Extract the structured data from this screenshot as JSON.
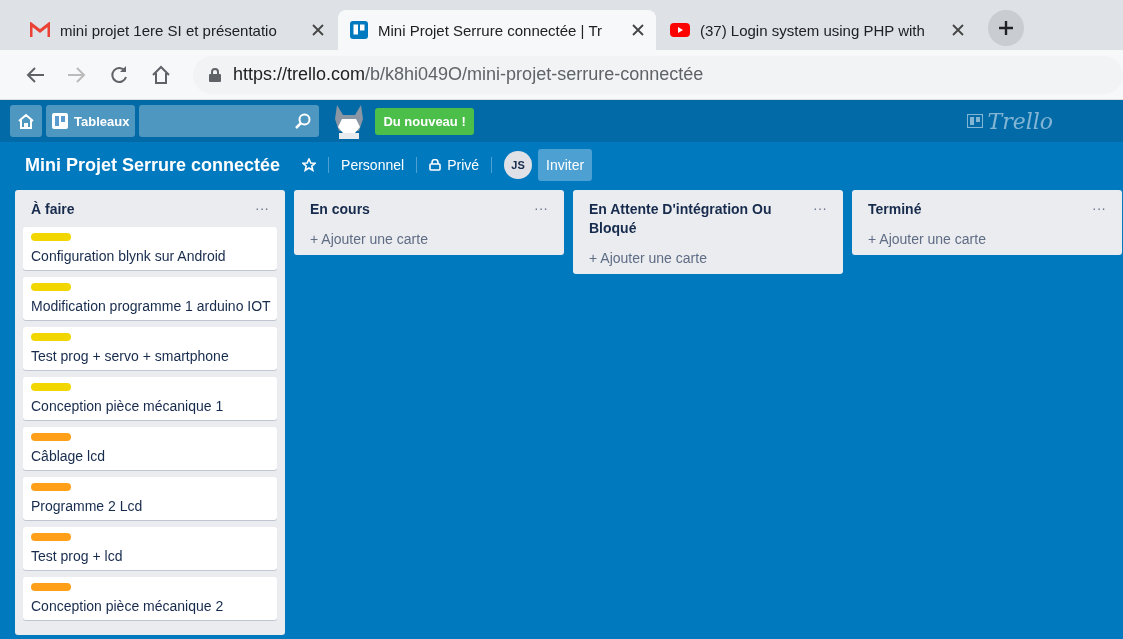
{
  "browser": {
    "tabs": [
      {
        "kind": "mail",
        "title": "mini projet 1ere SI et présentatio",
        "selected": false
      },
      {
        "kind": "board",
        "title": "Mini Projet Serrure connectée | Tr",
        "selected": true
      },
      {
        "kind": "video",
        "title": "(37) Login system using PHP with",
        "selected": false
      }
    ],
    "address": {
      "host": "https://trello.com",
      "path": "/b/k8hi049O/mini-projet-serrure-connectée"
    }
  },
  "header": {
    "boards_button": "Tableaux",
    "news_badge": "Du nouveau !",
    "logo": "Trello"
  },
  "board": {
    "title": "Mini Projet Serrure connectée",
    "team": "Personnel",
    "visibility": "Privé",
    "member_initials": "JS",
    "invite_button": "Inviter"
  },
  "lists": [
    {
      "title": "À faire",
      "menu": "···",
      "cards": [
        {
          "title": "Configuration blynk sur Android",
          "color": "#f2d600"
        },
        {
          "title": "Modification programme 1 arduino IOT",
          "color": "#f2d600"
        },
        {
          "title": "Test prog + servo + smartphone",
          "color": "#f2d600"
        },
        {
          "title": "Conception pièce mécanique 1",
          "color": "#f2d600"
        },
        {
          "title": "Câblage lcd",
          "color": "#ff9f1a"
        },
        {
          "title": "Programme 2 Lcd",
          "color": "#ff9f1a"
        },
        {
          "title": "Test prog + lcd",
          "color": "#ff9f1a"
        },
        {
          "title": "Conception pièce mécanique 2",
          "color": "#ff9f1a"
        }
      ]
    },
    {
      "title": "En cours",
      "menu": "···",
      "add_card": "+ Ajouter une carte"
    },
    {
      "title": "En Attente D'intégration Ou Bloqué",
      "menu": "···",
      "add_card": "+ Ajouter une carte"
    },
    {
      "title": "Terminé",
      "menu": "···",
      "add_card": "+ Ajouter une carte"
    }
  ]
}
